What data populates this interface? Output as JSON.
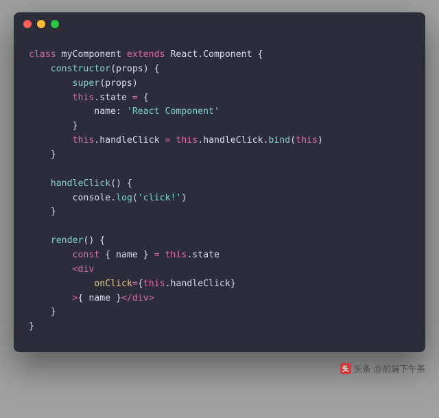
{
  "titlebar": {
    "dots": [
      "close",
      "minimize",
      "zoom"
    ]
  },
  "code": {
    "l1_kw1": "class",
    "l1_name": " myComponent ",
    "l1_kw2": "extends",
    "l1_super": " React.Component ",
    "l1_brace": "{",
    "l2_indent": "    ",
    "l2_fn": "constructor",
    "l2_paren": "(props) {",
    "l3_indent": "        ",
    "l3_fn": "super",
    "l3_rest": "(props)",
    "l4_indent": "        ",
    "l4_this": "this",
    "l4_rest1": ".state ",
    "l4_op": "=",
    "l4_rest2": " {",
    "l5_indent": "            ",
    "l5_key": "name: ",
    "l5_str": "'React Component'",
    "l6_indent": "        ",
    "l6_brace": "}",
    "l7_indent": "        ",
    "l7_this1": "this",
    "l7_p1": ".handleClick ",
    "l7_op": "=",
    "l7_sp": " ",
    "l7_this2": "this",
    "l7_p2": ".handleClick.",
    "l7_fn": "bind",
    "l7_p3": "(",
    "l7_this3": "this",
    "l7_p4": ")",
    "l8_indent": "    ",
    "l8_brace": "}",
    "l10_indent": "    ",
    "l10_fn": "handleClick",
    "l10_rest": "() {",
    "l11_indent": "        ",
    "l11_obj": "console.",
    "l11_fn": "log",
    "l11_p1": "(",
    "l11_str": "'click!'",
    "l11_p2": ")",
    "l12_indent": "    ",
    "l12_brace": "}",
    "l14_indent": "    ",
    "l14_fn": "render",
    "l14_rest": "() {",
    "l15_indent": "        ",
    "l15_kw": "const",
    "l15_p1": " { name } ",
    "l15_op": "=",
    "l15_sp": " ",
    "l15_this": "this",
    "l15_p2": ".state",
    "l16_indent": "        ",
    "l16_lt": "<",
    "l16_tag": "div",
    "l17_indent": "            ",
    "l17_attr": "onClick",
    "l17_eq": "=",
    "l17_b1": "{",
    "l17_this": "this",
    "l17_p": ".handleClick",
    "l17_b2": "}",
    "l18_indent": "        ",
    "l18_gt": ">",
    "l18_b1": "{ name }",
    "l18_lt": "</",
    "l18_tag": "div",
    "l18_gt2": ">",
    "l19_indent": "    ",
    "l19_brace": "}",
    "l20_brace": "}"
  },
  "watermark": {
    "prefix": "头条",
    "handle": "@前端下午茶"
  }
}
